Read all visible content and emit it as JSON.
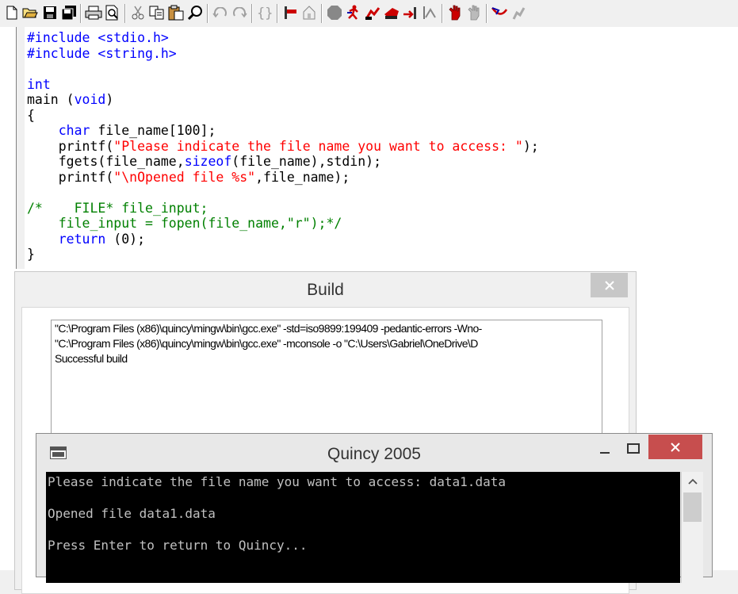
{
  "toolbar": {
    "buttons": [
      "new-file",
      "open-folder",
      "save",
      "save-all",
      "print",
      "print-preview",
      "cut",
      "copy",
      "paste",
      "find",
      "undo",
      "redo",
      "braces",
      "step",
      "home",
      "stop",
      "run",
      "debug",
      "build",
      "step-over",
      "step-into",
      "watch",
      "breakpoint",
      "go",
      "tools"
    ]
  },
  "editor": {
    "lines": [
      [
        {
          "t": "#include <stdio.h>",
          "c": "pp"
        }
      ],
      [
        {
          "t": "#include <string.h>",
          "c": "pp"
        }
      ],
      [
        {
          "t": "",
          "c": ""
        }
      ],
      [
        {
          "t": "int",
          "c": "kw"
        }
      ],
      [
        {
          "t": "main (",
          "c": ""
        },
        {
          "t": "void",
          "c": "kw"
        },
        {
          "t": ")",
          "c": ""
        }
      ],
      [
        {
          "t": "{",
          "c": ""
        }
      ],
      [
        {
          "t": "    ",
          "c": ""
        },
        {
          "t": "char",
          "c": "kw"
        },
        {
          "t": " file_name[100];",
          "c": ""
        }
      ],
      [
        {
          "t": "    printf(",
          "c": ""
        },
        {
          "t": "\"Please indicate the file name you want to access: \"",
          "c": "str"
        },
        {
          "t": ");",
          "c": ""
        }
      ],
      [
        {
          "t": "    fgets(file_name,",
          "c": ""
        },
        {
          "t": "sizeof",
          "c": "kw"
        },
        {
          "t": "(file_name),stdin);",
          "c": ""
        }
      ],
      [
        {
          "t": "    printf(",
          "c": ""
        },
        {
          "t": "\"\\nOpened file %s\"",
          "c": "str"
        },
        {
          "t": ",file_name);",
          "c": ""
        }
      ],
      [
        {
          "t": "",
          "c": ""
        }
      ],
      [
        {
          "t": "/*    FILE* file_input;",
          "c": "cmt"
        }
      ],
      [
        {
          "t": "    file_input = fopen(file_name,\"r\");*/",
          "c": "cmt"
        }
      ],
      [
        {
          "t": "    ",
          "c": ""
        },
        {
          "t": "return",
          "c": "kw"
        },
        {
          "t": " (0);",
          "c": ""
        }
      ],
      [
        {
          "t": "}",
          "c": ""
        }
      ]
    ]
  },
  "build_dialog": {
    "title": "Build",
    "output_lines": [
      "\"C:\\Program Files (x86)\\quincy\\mingw\\bin\\gcc.exe\" -std=iso9899:199409 -pedantic-errors -Wno-",
      "\"C:\\Program Files (x86)\\quincy\\mingw\\bin\\gcc.exe\" -mconsole -o \"C:\\Users\\Gabriel\\OneDrive\\D",
      "Successful build"
    ]
  },
  "console": {
    "title": "Quincy 2005",
    "lines": [
      "Please indicate the file name you want to access: data1.data",
      "",
      "Opened file data1.data",
      "",
      "Press Enter to return to Quincy..."
    ]
  }
}
